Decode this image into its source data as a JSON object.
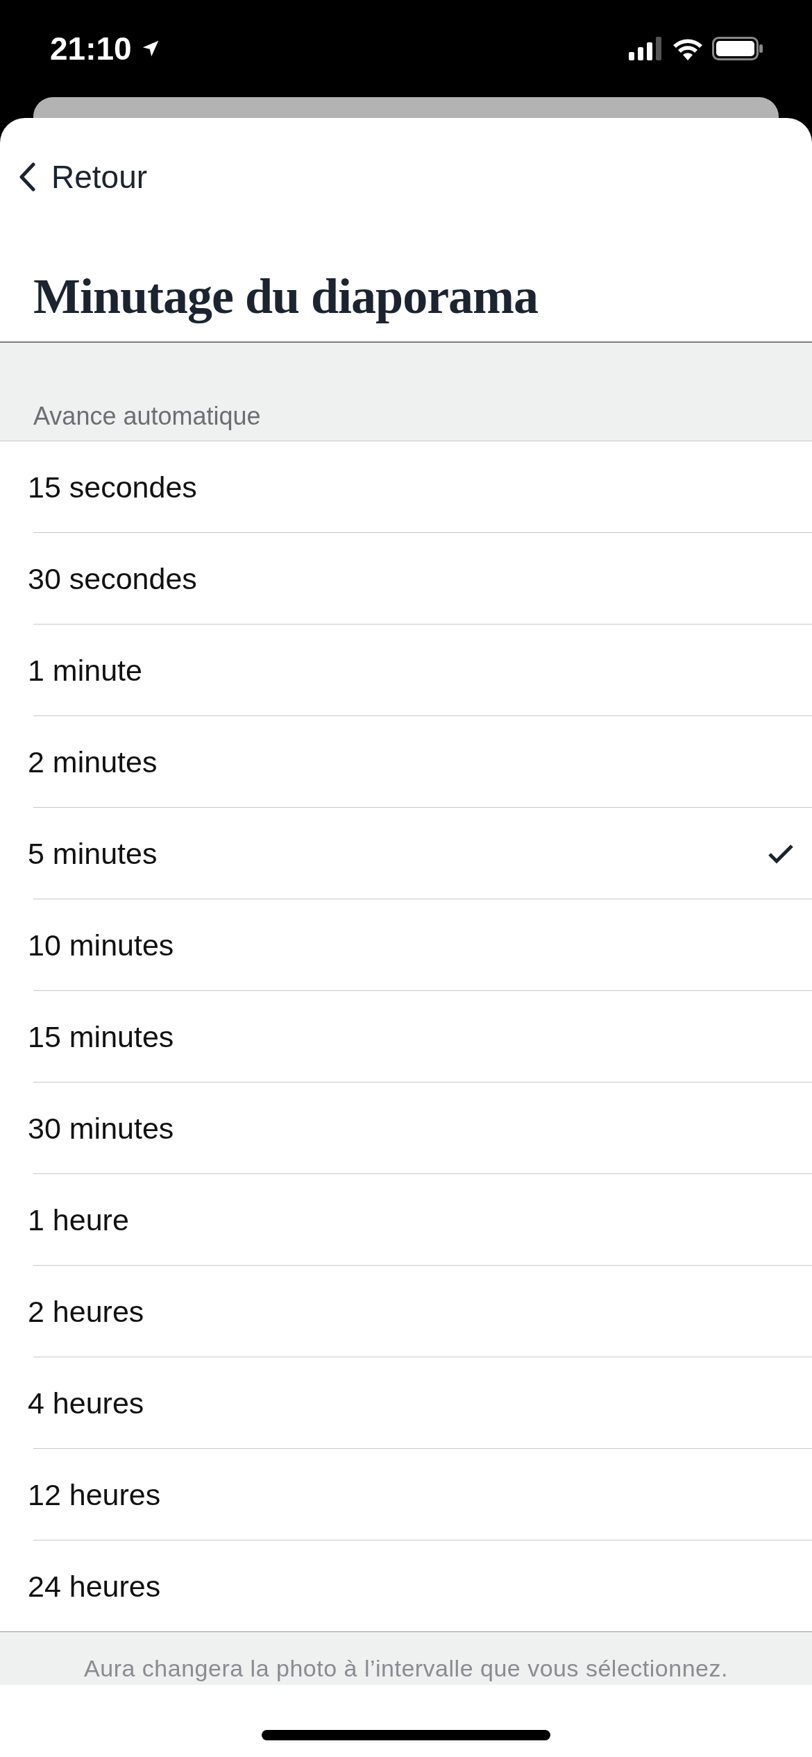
{
  "status_bar": {
    "time": "21:10"
  },
  "nav": {
    "back_label": "Retour"
  },
  "title": "Minutage du diaporama",
  "section": {
    "header": "Avance automatique",
    "footer": "Aura changera la photo à l’intervalle que vous sélectionnez."
  },
  "options": [
    {
      "label": "15 secondes",
      "selected": false
    },
    {
      "label": "30 secondes",
      "selected": false
    },
    {
      "label": "1 minute",
      "selected": false
    },
    {
      "label": "2 minutes",
      "selected": false
    },
    {
      "label": "5 minutes",
      "selected": true
    },
    {
      "label": "10 minutes",
      "selected": false
    },
    {
      "label": "15 minutes",
      "selected": false
    },
    {
      "label": "30 minutes",
      "selected": false
    },
    {
      "label": "1 heure",
      "selected": false
    },
    {
      "label": "2 heures",
      "selected": false
    },
    {
      "label": "4 heures",
      "selected": false
    },
    {
      "label": "12 heures",
      "selected": false
    },
    {
      "label": "24 heures",
      "selected": false
    }
  ]
}
